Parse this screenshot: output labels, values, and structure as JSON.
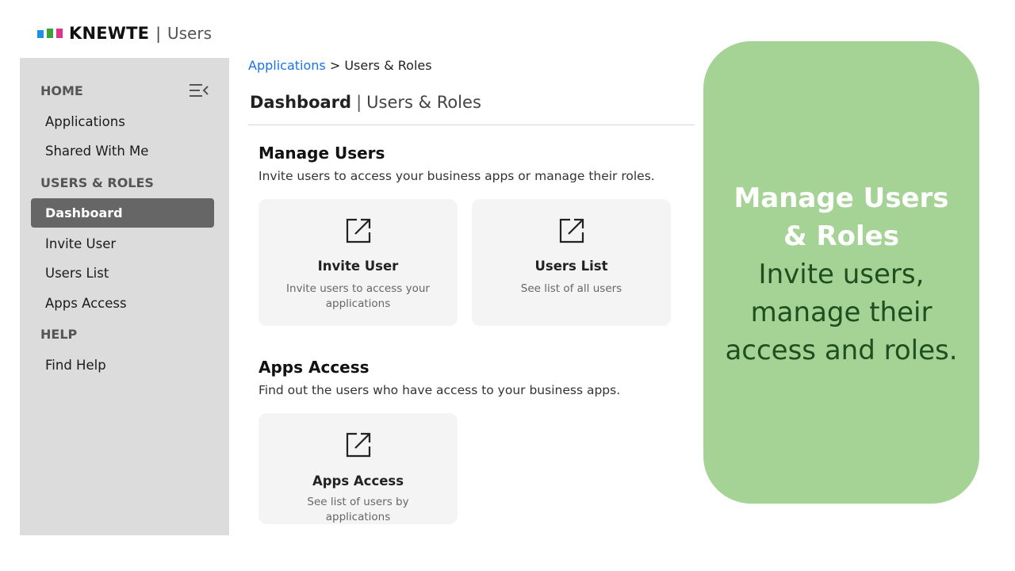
{
  "app": {
    "brand": "KNEWTE",
    "separator": "|",
    "section": "Users",
    "logo_colors": [
      "#1e90e8",
      "#3aa33a",
      "#e0338a"
    ]
  },
  "sidebar": {
    "home_heading": "HOME",
    "items_home": [
      "Applications",
      "Shared With Me"
    ],
    "users_heading": "USERS & ROLES",
    "active_item": "Dashboard",
    "items_users": [
      "Invite User",
      "Users List",
      "Apps Access"
    ],
    "help_heading": "HELP",
    "items_help": [
      "Find Help"
    ]
  },
  "breadcrumb": {
    "link": "Applications",
    "separator": ">",
    "current": "Users & Roles"
  },
  "page_title": {
    "main": "Dashboard",
    "separator": "|",
    "sub": "Users & Roles"
  },
  "manage_users": {
    "title": "Manage Users",
    "description": "Invite users to access your business apps or manage their roles.",
    "cards": [
      {
        "title": "Invite User",
        "description": "Invite users to access your applications",
        "icon": "external-link-icon"
      },
      {
        "title": "Users List",
        "description": "See list of all users",
        "icon": "external-link-icon"
      }
    ]
  },
  "apps_access": {
    "title": "Apps Access",
    "description": "Find out the users who have access to your business apps.",
    "cards": [
      {
        "title": "Apps Access",
        "description": "See list of users by applications",
        "icon": "external-link-icon"
      }
    ]
  },
  "callout": {
    "title_line1": "Manage Users",
    "title_line2": "& Roles",
    "body_line1": "Invite users,",
    "body_line2": "manage their",
    "body_line3": "access and roles.",
    "background": "#a5d395"
  },
  "colors": {
    "sidebar_bg": "#dcdcdc",
    "active_bg": "#666666",
    "link": "#1a73e8",
    "card_bg": "#f4f4f4"
  }
}
